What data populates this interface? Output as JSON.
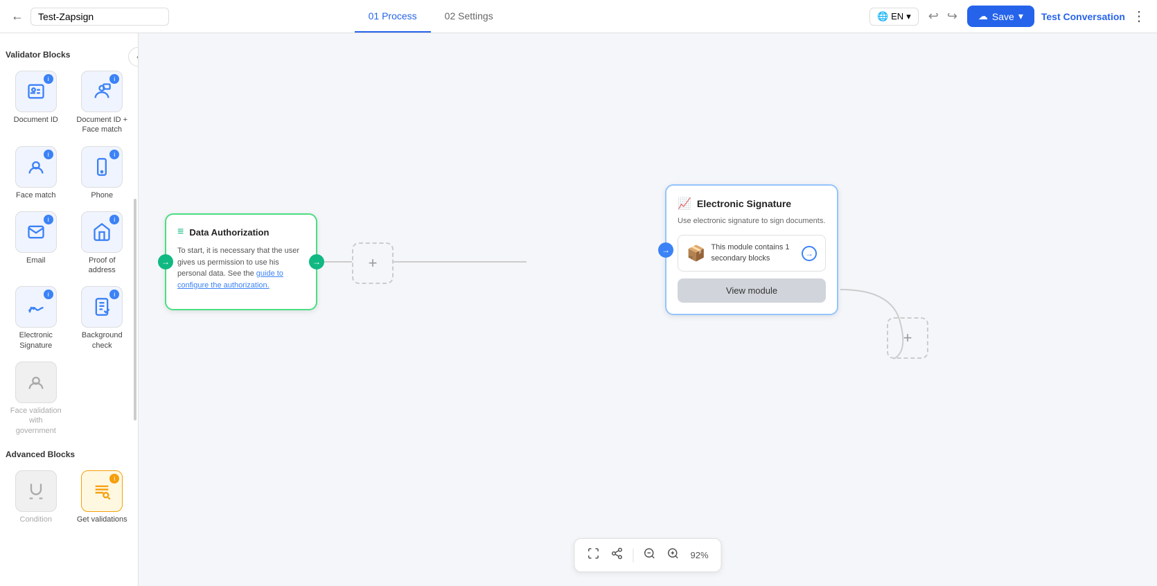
{
  "header": {
    "back_label": "←",
    "title_value": "Test-Zapsign",
    "tabs": [
      {
        "id": "process",
        "label": "01 Process",
        "active": true
      },
      {
        "id": "settings",
        "label": "02 Settings",
        "active": false
      }
    ],
    "lang": "EN",
    "save_label": "Save",
    "test_conversation_label": "Test Conversation",
    "more_icon": "⋮"
  },
  "sidebar": {
    "toggle_icon": "‹",
    "validator_section": "Validator Blocks",
    "advanced_section": "Advanced Blocks",
    "validator_blocks": [
      {
        "id": "document-id",
        "label": "Document ID",
        "icon": "id",
        "disabled": false
      },
      {
        "id": "document-id-face",
        "label": "Document ID + Face match",
        "icon": "id-face",
        "disabled": false
      },
      {
        "id": "face-match",
        "label": "Face match",
        "icon": "face",
        "disabled": false
      },
      {
        "id": "phone",
        "label": "Phone",
        "icon": "phone",
        "disabled": false
      },
      {
        "id": "email",
        "label": "Email",
        "icon": "email",
        "disabled": false
      },
      {
        "id": "proof-address",
        "label": "Proof of address",
        "icon": "address",
        "disabled": false
      },
      {
        "id": "electronic-signature",
        "label": "Electronic Signature",
        "icon": "esign",
        "disabled": false
      },
      {
        "id": "background-check",
        "label": "Background check",
        "icon": "bg-check",
        "disabled": false
      },
      {
        "id": "face-gov",
        "label": "Face validation with government",
        "icon": "face-gov",
        "disabled": true
      }
    ],
    "advanced_blocks": [
      {
        "id": "condition",
        "label": "Condition",
        "icon": "condition",
        "disabled": true
      },
      {
        "id": "get-validations",
        "label": "Get validations",
        "icon": "get-valid",
        "disabled": false,
        "highlight": true
      }
    ]
  },
  "canvas": {
    "nodes": {
      "data_auth": {
        "title": "Data Authorization",
        "body": "To start, it is necessary that the user gives us permission to use his personal data. See the",
        "link_text": "guide to configure the authorization.",
        "link_href": "#"
      },
      "esign": {
        "title": "Electronic Signature",
        "subtitle": "Use electronic signature to sign documents.",
        "secondary_text": "This module contains 1 secondary blocks",
        "view_module_label": "View module"
      }
    },
    "toolbar": {
      "zoom_value": "92%"
    }
  }
}
